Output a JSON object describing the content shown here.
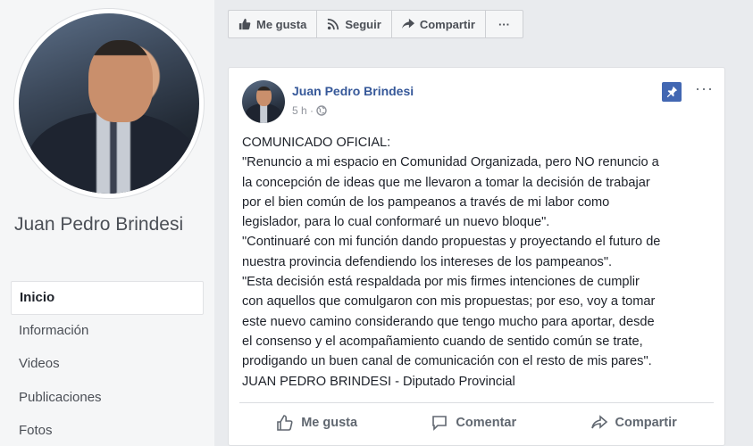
{
  "sidebar": {
    "page_name": "Juan Pedro Brindesi",
    "nav": [
      {
        "label": "Inicio",
        "active": true
      },
      {
        "label": "Información",
        "active": false
      },
      {
        "label": "Videos",
        "active": false
      },
      {
        "label": "Publicaciones",
        "active": false
      },
      {
        "label": "Fotos",
        "active": false
      }
    ]
  },
  "action_bar": {
    "like": "Me gusta",
    "follow": "Seguir",
    "share": "Compartir",
    "more": "···"
  },
  "post": {
    "author": "Juan Pedro Brindesi",
    "time": "5 h ·",
    "more": "···",
    "body": [
      "COMUNICADO OFICIAL:",
      "\"Renuncio a mi espacio en Comunidad Organizada, pero NO renuncio a",
      "la concepción de ideas que me llevaron a tomar la decisión de trabajar",
      "por el bien común de los pampeanos a través de mi labor como",
      "legislador, para lo cual conformaré un nuevo bloque\".",
      "\"Continuaré con mi función dando propuestas y proyectando el futuro de",
      "nuestra provincia defendiendo los intereses de los pampeanos\".",
      "\"Esta decisión está respaldada por mis firmes intenciones de cumplir",
      "con aquellos que comulgaron con mis propuestas; por eso, voy a tomar",
      "este nuevo camino considerando que tengo mucho para aportar, desde",
      "el consenso y el acompañamiento cuando de sentido común se trate,",
      "prodigando un buen canal de comunicación con el resto de mis pares\".",
      "JUAN PEDRO BRINDESI - Diputado Provincial"
    ],
    "actions": {
      "like": "Me gusta",
      "comment": "Comentar",
      "share": "Compartir"
    }
  },
  "colors": {
    "link": "#365899",
    "pin": "#4267b2",
    "background": "#e9ebee"
  }
}
